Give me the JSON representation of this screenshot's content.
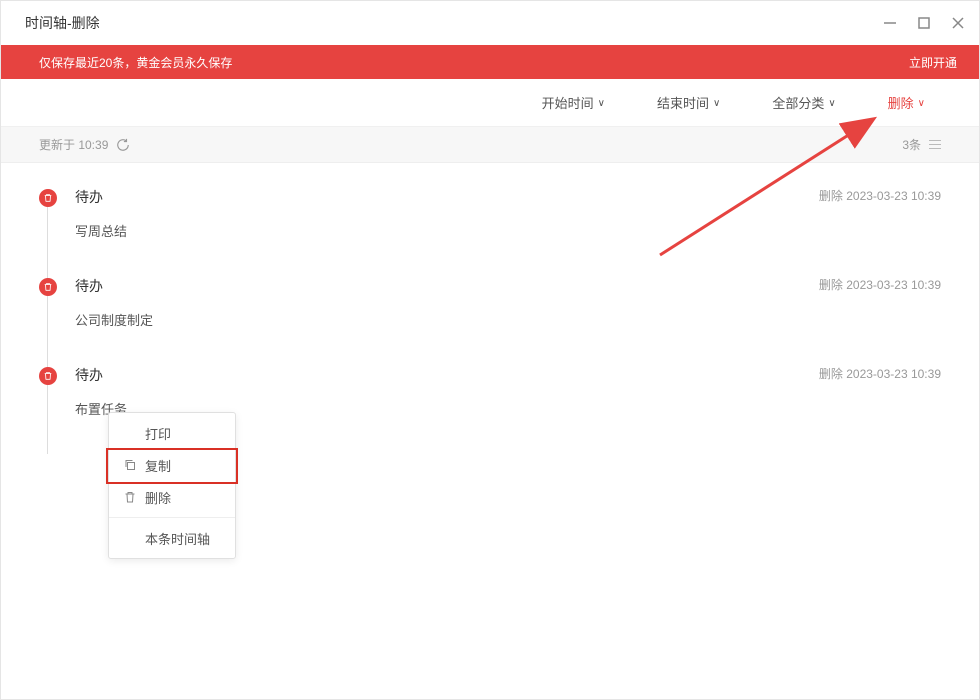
{
  "window": {
    "title": "时间轴-删除"
  },
  "banner": {
    "left": "仅保存最近20条，黄金会员永久保存",
    "right": "立即开通"
  },
  "filters": {
    "start": "开始时间",
    "end": "结束时间",
    "category": "全部分类",
    "delete": "删除"
  },
  "status": {
    "updated_label": "更新于 10:39",
    "count_label": "3条"
  },
  "entries": [
    {
      "type": "待办",
      "body": "写周总结",
      "meta": "删除 2023-03-23 10:39"
    },
    {
      "type": "待办",
      "body": "公司制度制定",
      "meta": "删除 2023-03-23 10:39"
    },
    {
      "type": "待办",
      "body": "布置任务",
      "meta": "删除 2023-03-23 10:39"
    }
  ],
  "ctx": {
    "print": "打印",
    "copy": "复制",
    "delete": "删除",
    "this_timeline": "本条时间轴"
  },
  "icons": {
    "trash": "trash-icon",
    "refresh": "refresh-icon",
    "copy": "copy-icon",
    "print": "print-icon",
    "close": "close-icon",
    "minimize": "minimize-icon",
    "maximize": "maximize-icon",
    "menu": "menu-icon",
    "chevron": "∨"
  }
}
